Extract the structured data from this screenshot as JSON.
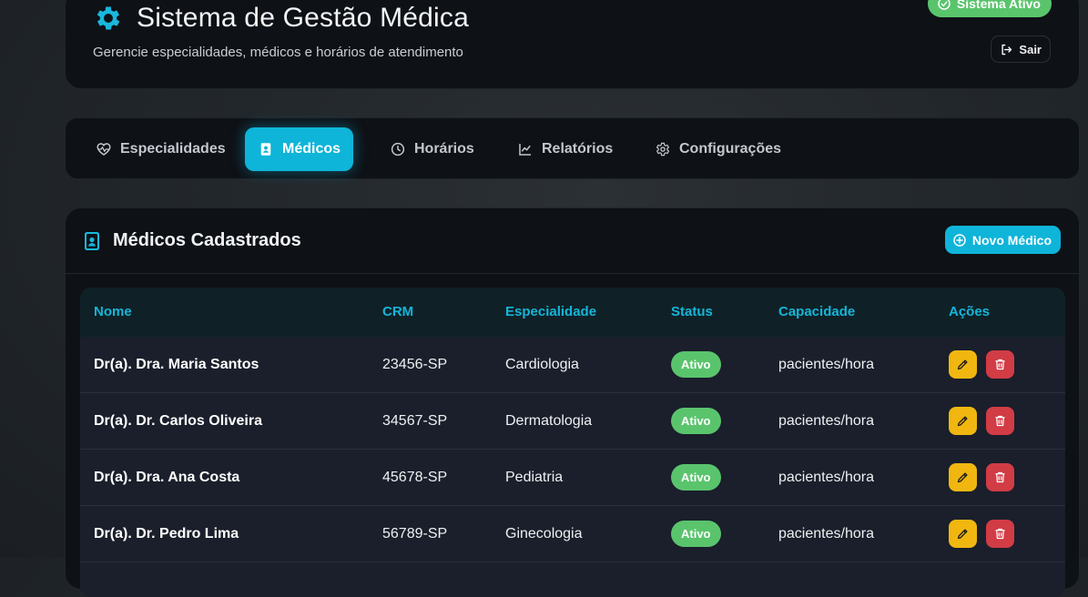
{
  "header": {
    "title": "Sistema de Gestão Médica",
    "subtitle": "Gerencie especialidades, médicos e horários de atendimento",
    "status_label": "Sistema Ativo",
    "logout_label": "Sair",
    "icon": "gear-icon"
  },
  "nav": {
    "tabs": [
      {
        "label": "Especialidades",
        "icon": "heart-pulse-icon",
        "active": false
      },
      {
        "label": "Médicos",
        "icon": "id-badge-icon",
        "active": true
      },
      {
        "label": "Horários",
        "icon": "clock-icon",
        "active": false
      },
      {
        "label": "Relatórios",
        "icon": "line-chart-icon",
        "active": false
      },
      {
        "label": "Configurações",
        "icon": "gear-icon",
        "active": false
      }
    ]
  },
  "main": {
    "title": "Médicos Cadastrados",
    "new_button_label": "Novo Médico",
    "columns": [
      "Nome",
      "CRM",
      "Especialidade",
      "Status",
      "Capacidade",
      "Ações"
    ],
    "rows": [
      {
        "nome": "Dr(a). Dra. Maria Santos",
        "crm": "23456-SP",
        "especialidade": "Cardiologia",
        "status": "Ativo",
        "capacidade": "pacientes/hora"
      },
      {
        "nome": "Dr(a). Dr. Carlos Oliveira",
        "crm": "34567-SP",
        "especialidade": "Dermatologia",
        "status": "Ativo",
        "capacidade": "pacientes/hora"
      },
      {
        "nome": "Dr(a). Dra. Ana Costa",
        "crm": "45678-SP",
        "especialidade": "Pediatria",
        "status": "Ativo",
        "capacidade": "pacientes/hora"
      },
      {
        "nome": "Dr(a). Dr. Pedro Lima",
        "crm": "56789-SP",
        "especialidade": "Ginecologia",
        "status": "Ativo",
        "capacidade": "pacientes/hora"
      }
    ]
  },
  "colors": {
    "accent": "#0fb4d9",
    "success": "#5ac46d",
    "edit": "#f1b710",
    "delete": "#d13c45"
  }
}
